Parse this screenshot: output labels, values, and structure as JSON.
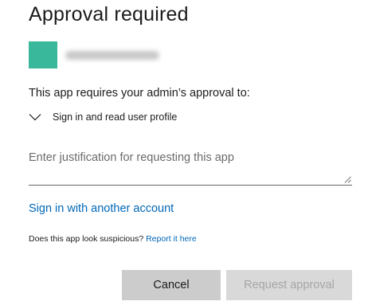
{
  "dialog": {
    "title": "Approval required",
    "app": {
      "logo_color": "#3ab89b",
      "name_redacted": true
    },
    "requirement_text": "This app requires your admin’s approval to:",
    "permissions": [
      {
        "label": "Sign in and read user profile",
        "icon": "chevron-down-icon"
      }
    ],
    "justification": {
      "placeholder": "Enter justification for requesting this app",
      "value": ""
    },
    "sign_in_another_label": "Sign in with another account",
    "suspicious": {
      "question": "Does this app look suspicious? ",
      "report_label": "Report it here"
    },
    "buttons": {
      "cancel_label": "Cancel",
      "request_label": "Request approval",
      "request_enabled": false
    }
  },
  "colors": {
    "link": "#0067b8",
    "text": "#1b1b1b",
    "cancel_bg": "#cccccc",
    "disabled_bg": "#d9d9d9",
    "disabled_text": "#a6a6a6"
  }
}
